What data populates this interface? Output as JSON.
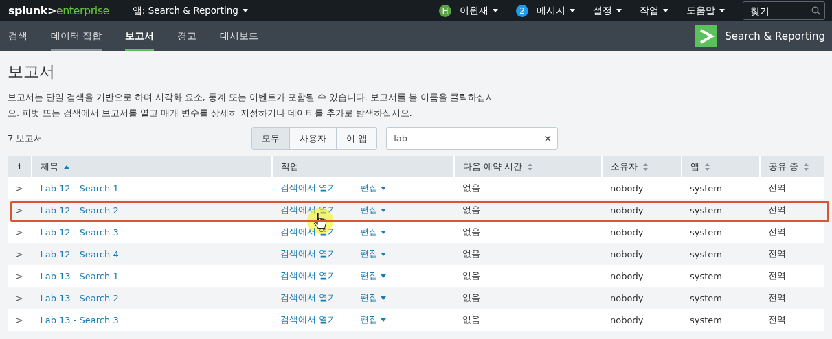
{
  "top_bar": {
    "logo_left": "splunk>",
    "logo_right": "enterprise",
    "app_menu": "앱: Search & Reporting",
    "menus": [
      {
        "kind": "user",
        "badge": "H",
        "label": "이원재"
      },
      {
        "kind": "messages",
        "badge": "2",
        "label": "메시지"
      },
      {
        "kind": "plain",
        "label": "설정"
      },
      {
        "kind": "plain",
        "label": "작업"
      },
      {
        "kind": "plain",
        "label": "도움말"
      }
    ],
    "search": {
      "placeholder": "찾기"
    }
  },
  "nav": {
    "tabs": [
      {
        "label": "검색",
        "selected": false,
        "hovered": false
      },
      {
        "label": "데이터 집합",
        "selected": false,
        "hovered": true
      },
      {
        "label": "보고서",
        "selected": true,
        "hovered": false
      },
      {
        "label": "경고",
        "selected": false,
        "hovered": false
      },
      {
        "label": "대시보드",
        "selected": false,
        "hovered": false
      }
    ],
    "app_title": "Search & Reporting"
  },
  "page": {
    "title": "보고서",
    "description": "보고서는 단일 검색을 기반으로 하며 시각화 요소, 통계 또는 이벤트가 포함될 수 있습니다. 보고서를 볼 이름을 클릭하십시오. 피벗 또는 검색에서 보고서를 열고 매개 변수를 상세히 지정하거나 데이터를 추가로 탐색하십시오.",
    "count": "7 보고서",
    "filters": [
      {
        "label": "모두",
        "selected": true
      },
      {
        "label": "사용자",
        "selected": false
      },
      {
        "label": "이 앱",
        "selected": false
      }
    ],
    "filter_field": {
      "value": "lab",
      "clear": "✕"
    }
  },
  "table": {
    "columns": [
      {
        "label": "i",
        "sortable": false
      },
      {
        "label": "제목",
        "sortable": true,
        "sorted": true
      },
      {
        "label": "작업",
        "sortable": false
      },
      {
        "label": "다음 예약 시간",
        "sortable": true,
        "sorted": false
      },
      {
        "label": "소유자",
        "sortable": true,
        "sorted": false
      },
      {
        "label": "앱",
        "sortable": true,
        "sorted": false
      },
      {
        "label": "공유 중",
        "sortable": true,
        "sorted": false
      }
    ],
    "rows": [
      {
        "expander": ">",
        "title": "Lab 12 - Search 1",
        "open": "검색에서 열기",
        "edit": "편집",
        "next": "없음",
        "owner": "nobody",
        "app": "system",
        "sharing": "전역",
        "highlighted": false,
        "cursor": false
      },
      {
        "expander": ">",
        "title": "Lab 12 - Search 2",
        "open": "검색에서 열기",
        "edit": "편집",
        "next": "없음",
        "owner": "nobody",
        "app": "system",
        "sharing": "전역",
        "highlighted": true,
        "cursor": true
      },
      {
        "expander": ">",
        "title": "Lab 12 - Search 3",
        "open": "검색에서 열기",
        "edit": "편집",
        "next": "없음",
        "owner": "nobody",
        "app": "system",
        "sharing": "전역",
        "highlighted": false,
        "cursor": false
      },
      {
        "expander": ">",
        "title": "Lab 12 - Search 4",
        "open": "검색에서 열기",
        "edit": "편집",
        "next": "없음",
        "owner": "nobody",
        "app": "system",
        "sharing": "전역",
        "highlighted": false,
        "cursor": false
      },
      {
        "expander": ">",
        "title": "Lab 13 - Search 1",
        "open": "검색에서 열기",
        "edit": "편집",
        "next": "없음",
        "owner": "nobody",
        "app": "system",
        "sharing": "전역",
        "highlighted": false,
        "cursor": false
      },
      {
        "expander": ">",
        "title": "Lab 13 - Search 2",
        "open": "검색에서 열기",
        "edit": "편집",
        "next": "없음",
        "owner": "nobody",
        "app": "system",
        "sharing": "전역",
        "highlighted": false,
        "cursor": false
      },
      {
        "expander": ">",
        "title": "Lab 13 - Search 3",
        "open": "검색에서 열기",
        "edit": "편집",
        "next": "없음",
        "owner": "nobody",
        "app": "system",
        "sharing": "전역",
        "highlighted": false,
        "cursor": false
      }
    ]
  }
}
